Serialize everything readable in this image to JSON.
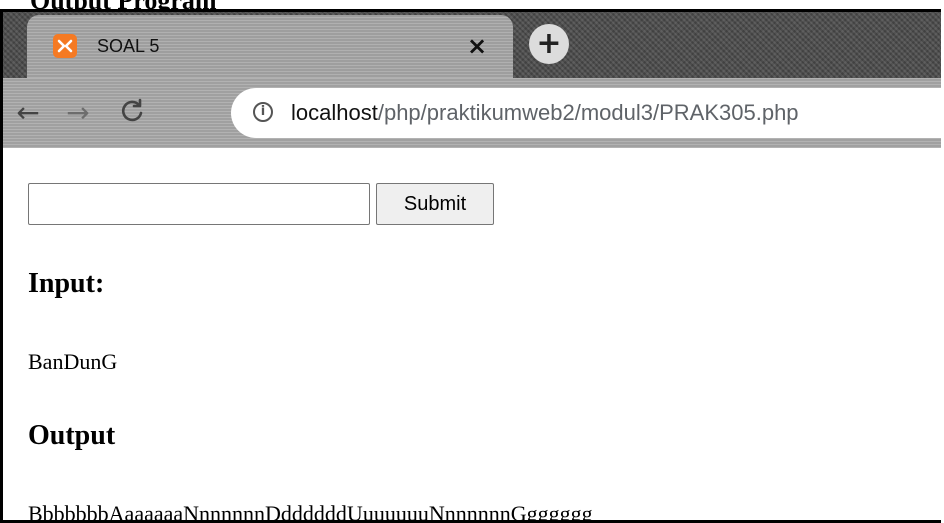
{
  "document": {
    "top_heading": "Output Program"
  },
  "browser": {
    "tab": {
      "title": "SOAL 5",
      "favicon": "xampp-icon",
      "close_glyph": "×"
    },
    "new_tab_glyph": "+",
    "toolbar": {
      "back_glyph": "←",
      "forward_glyph": "→",
      "reload_glyph": "C"
    },
    "address": {
      "info_glyph": "i",
      "host": "localhost",
      "path": "/php/praktikumweb2/modul3/PRAK305.php"
    }
  },
  "page": {
    "form": {
      "input_value": "",
      "input_placeholder": "",
      "submit_label": "Submit"
    },
    "input_heading": "Input:",
    "input_text": "BanDunG",
    "output_heading": "Output",
    "output_text": "BbbbbbbAaaaaaaNnnnnnnDddddddUuuuuuuNnnnnnnGgggggg"
  },
  "colors": {
    "favicon": "#f57a23",
    "url_path": "#5f6368"
  }
}
